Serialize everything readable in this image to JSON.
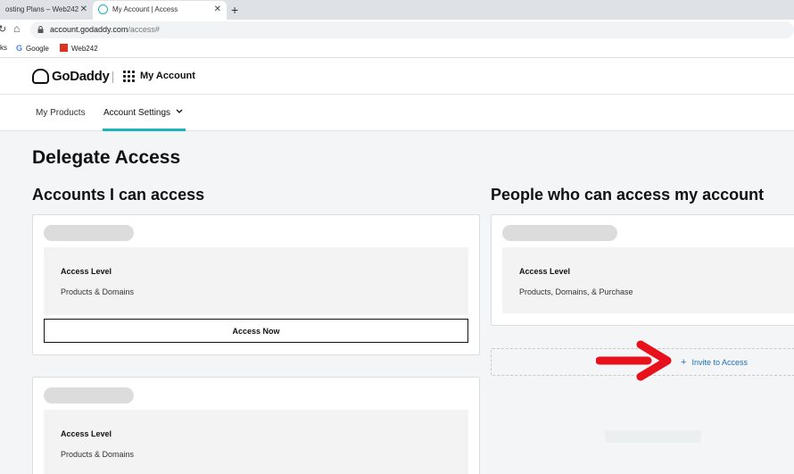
{
  "browser": {
    "tabs": [
      {
        "title": "osting Plans – Web242"
      },
      {
        "title": "My Account | Access"
      }
    ],
    "url_host": "account.godaddy.com",
    "url_path": "/access#",
    "bookmarks_prefix": "ks",
    "bookmarks": [
      {
        "label": "Google",
        "icon": "google-icon"
      },
      {
        "label": "Web242",
        "icon": "web242-icon"
      }
    ]
  },
  "header": {
    "logo_text": "GoDaddy",
    "app_title": "My Account",
    "nav": [
      {
        "label": "My Products"
      },
      {
        "label": "Account Settings"
      }
    ]
  },
  "page": {
    "title": "Delegate Access",
    "left_section": {
      "title": "Accounts I can access",
      "cards": [
        {
          "level_label": "Access Level",
          "level_value": "Products & Domains",
          "button": "Access Now"
        },
        {
          "level_label": "Access Level",
          "level_value": "Products & Domains"
        }
      ]
    },
    "right_section": {
      "title": "People who can access my account",
      "card": {
        "level_label": "Access Level",
        "level_value": "Products, Domains, & Purchase"
      },
      "invite_label": "Invite to Access"
    }
  },
  "colors": {
    "accent": "#1bb6b7",
    "link": "#1d6fb8",
    "annotation_arrow": "#e8101a"
  }
}
